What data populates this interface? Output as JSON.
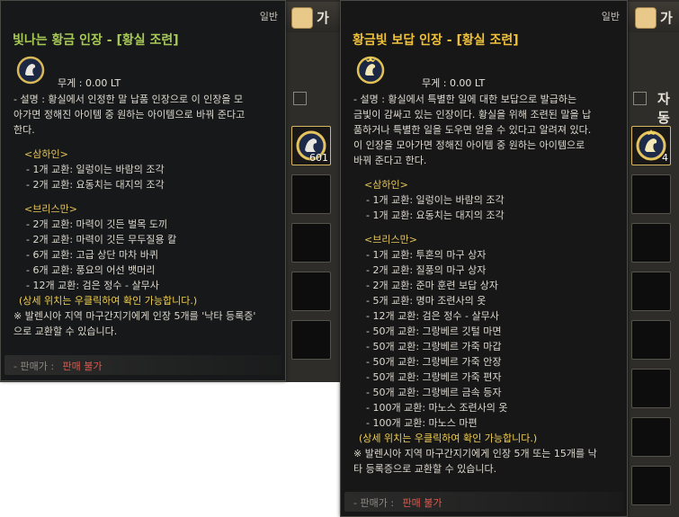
{
  "background_tab": {
    "label_left": "가",
    "label_right": "자동"
  },
  "inventory": {
    "slot_count_left": "601",
    "slot_count_right": "4"
  },
  "left_tooltip": {
    "category": "일반",
    "title": "빛나는 황금 인장 - [황실 조련]",
    "weight": "무게 :  0.00 LT",
    "desc_line1": "- 설명 : 황실에서 인정한 말 납품 인장으로 이 인장을 모",
    "desc_line2": "아가면 정해진 아이템 중 원하는 아이템으로 바꿔 준다고",
    "desc_line3": "한다.",
    "sec1_head": "<삼하인>",
    "sec1_items": [
      "- 1개 교환: 일렁이는 바람의 조각",
      "- 2개 교환: 요동치는 대지의 조각"
    ],
    "sec2_head": "<브리스만>",
    "sec2_items": [
      "- 2개 교환: 마력이 깃든 벌목 도끼",
      "- 2개 교환: 마력이 깃든 무두질용 칼",
      "- 6개 교환: 고급 상단 마차 바퀴",
      "- 6개 교환: 풍요의 어선 뱃머리",
      "- 12개 교환: 검은 정수 - 살무사"
    ],
    "detail_note": "(상세 위치는 우클릭하여 확인 가능합니다.)",
    "note_line1": "※ 발렌시아 지역 마구간지기에게 인장 5개를 '낙타 등록증'",
    "note_line2": "으로 교환할 수 있습니다.",
    "sell_label": "- 판매가 :",
    "sell_value": "판매 불가"
  },
  "right_tooltip": {
    "category": "일반",
    "title": "황금빛 보답 인장 - [황실 조련]",
    "weight": "무게 :  0.00 LT",
    "desc_line1": "- 설명 :  황실에서 특별한 일에 대한 보답으로 발급하는",
    "desc_line2": "금빛이 감싸고 있는 인장이다. 황실을 위해 조련된 말을 납",
    "desc_line3": "품하거나 특별한 일을 도우면 얻을 수 있다고 알려져 있다.",
    "desc_line4": " 이 인장을 모아가면 정해진 아이템 중 원하는 아이템으로",
    "desc_line5": "바꿔 준다고 한다.",
    "sec1_head": "<삼하인>",
    "sec1_items": [
      "- 1개 교환: 일렁이는 바람의 조각",
      "- 1개 교환: 요동치는 대지의 조각"
    ],
    "sec2_head": "<브리스만>",
    "sec2_items": [
      "- 1개 교환: 투혼의 마구 상자",
      "- 2개 교환: 질풍의 마구 상자",
      "- 2개 교환: 준마 훈련 보답 상자",
      "- 5개 교환: 명마 조련사의 옷",
      "- 12개 교환: 검은 정수 - 살무사",
      "- 50개 교환: 그랑베르 깃털 마면",
      "- 50개 교환: 그랑베르 가죽 마갑",
      "- 50개 교환: 그랑베르 가죽 안장",
      "- 50개 교환: 그랑베르 가죽 편자",
      "- 50개 교환: 그랑베르 금속 등자",
      "- 100개 교환: 마노스 조련사의 옷",
      "- 100개 교환: 마노스 마편"
    ],
    "detail_note": "(상세 위치는 우클릭하여 확인 가능합니다.)",
    "note_line1": "※ 발렌시아 지역 마구간지기에게 인장 5개 또는 15개를 낙",
    "note_line2": "타 등록증으로 교환할 수 있습니다.",
    "sell_label": "- 판매가 :",
    "sell_value": "판매 불가"
  },
  "colors": {
    "title_green": "#a8c957",
    "title_gold": "#f0c23a",
    "section_gold": "#e4c65a",
    "sell_red": "#e0584d"
  }
}
